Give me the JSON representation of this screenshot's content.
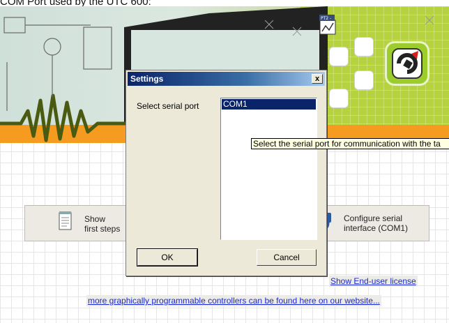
{
  "caption": "COM Port used by the UTC 600:",
  "banner": {
    "pt2_label": "PT2 -",
    "logo": "ledon-logo"
  },
  "main_buttons": {
    "first_steps": "Show\nfirst steps",
    "configure_serial": "Configure serial\ninterface (COM1)"
  },
  "links": {
    "license": "Show End-user license",
    "more_controllers": "more graphically programmable controllers can be found here on our website..."
  },
  "dialog": {
    "title": "Settings",
    "close": "x",
    "serial_label": "Select serial port",
    "ports": [
      "COM1"
    ],
    "selected_port": "COM1",
    "ok": "OK",
    "cancel": "Cancel"
  },
  "tooltip": "Select the serial port for communication with the ta"
}
